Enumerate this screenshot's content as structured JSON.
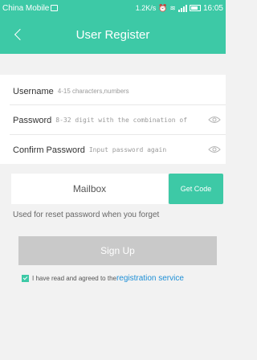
{
  "status_bar": {
    "carrier": "China Mobile",
    "speed": "1.2K/s",
    "time": "16:05"
  },
  "nav": {
    "title": "User Register"
  },
  "form": {
    "username": {
      "label": "Username",
      "placeholder": "4-15 characters,numbers"
    },
    "password": {
      "label": "Password",
      "placeholder": "8-32 digit with the combination of"
    },
    "confirm": {
      "label": "Confirm Password",
      "placeholder": "Input password again"
    }
  },
  "mailbox": {
    "placeholder": "Mailbox",
    "get_code_label": "Get Code",
    "hint": "Used for reset password when you forget"
  },
  "signup_label": "Sign Up",
  "agreement": {
    "checked": true,
    "text": "I have read and agreed to the",
    "link_text": "registration service"
  },
  "colors": {
    "accent": "#3dc9a6",
    "link": "#1e8fd6",
    "disabled_button": "#c9c9c9"
  }
}
